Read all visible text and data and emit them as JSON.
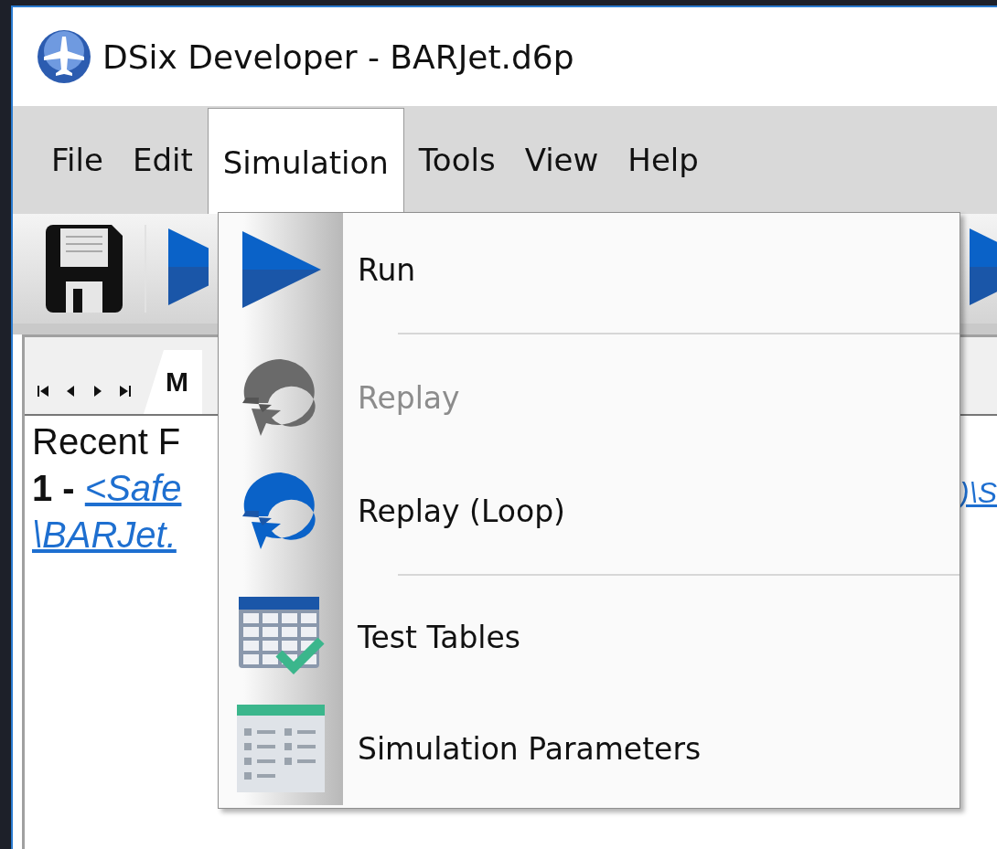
{
  "window": {
    "title": "DSix Developer - BARJet.d6p"
  },
  "menu_bar": [
    {
      "label": "File",
      "selected": false
    },
    {
      "label": "Edit",
      "selected": false
    },
    {
      "label": "Simulation",
      "selected": true
    },
    {
      "label": "Tools",
      "selected": false
    },
    {
      "label": "View",
      "selected": false
    },
    {
      "label": "Help",
      "selected": false
    }
  ],
  "tabs": [
    {
      "label": "M",
      "selected": true
    }
  ],
  "content": {
    "heading": "Recent F",
    "entry_number": "1 - ",
    "entry_link": "<Safe",
    "entry_link_line2": "\\BARJet.",
    "entry_link_right": ")\\S"
  },
  "dropdown": [
    {
      "kind": "item",
      "label": "Run",
      "disabled": false
    },
    {
      "kind": "separator"
    },
    {
      "kind": "item",
      "label": "Replay",
      "disabled": true
    },
    {
      "kind": "item",
      "label": "Replay (Loop)",
      "disabled": false
    },
    {
      "kind": "separator"
    },
    {
      "kind": "item",
      "label": "Test Tables",
      "disabled": false
    },
    {
      "kind": "item",
      "label": "Simulation Parameters",
      "disabled": false
    }
  ]
}
